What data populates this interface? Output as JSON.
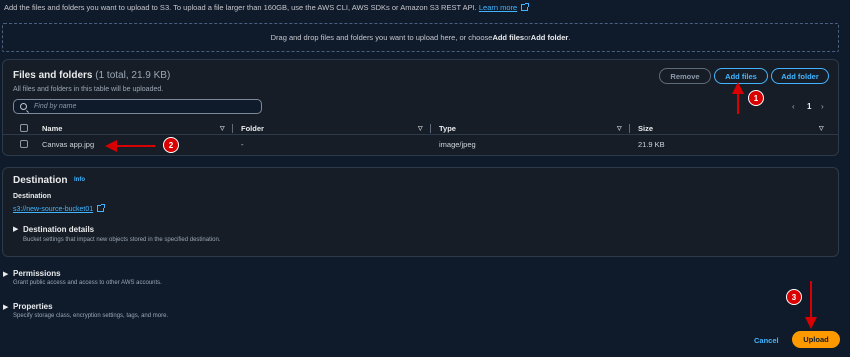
{
  "intro": {
    "text": "Add the files and folders you want to upload to S3. To upload a file larger than 160GB, use the AWS CLI, AWS SDKs or Amazon S3 REST API.",
    "learn_more": "Learn more"
  },
  "dropzone": {
    "prefix": "Drag and drop files and folders you want to upload here, or choose ",
    "add_files": "Add files",
    "or": " or ",
    "add_folder": "Add folder",
    "suffix": "."
  },
  "files_panel": {
    "title": "Files and folders",
    "count": "(1 total, 21.9 KB)",
    "subtitle": "All files and folders in this table will be uploaded.",
    "remove_label": "Remove",
    "add_files_label": "Add files",
    "add_folder_label": "Add folder",
    "search_placeholder": "Find by name",
    "pagination": {
      "prev": "‹",
      "page": "1",
      "next": "›"
    },
    "columns": [
      "Name",
      "Folder",
      "Type",
      "Size"
    ],
    "rows": [
      {
        "name": "Canvas app.jpg",
        "folder": "-",
        "type": "image/jpeg",
        "size": "21.9 KB"
      }
    ]
  },
  "destination": {
    "title": "Destination",
    "info": "Info",
    "label": "Destination",
    "value": "s3://new-source-bucket01",
    "details_title": "Destination details",
    "details_sub": "Bucket settings that impact new objects stored in the specified destination."
  },
  "permissions": {
    "title": "Permissions",
    "sub": "Grant public access and access to other AWS accounts."
  },
  "properties": {
    "title": "Properties",
    "sub": "Specify storage class, encryption settings, tags, and more."
  },
  "footer": {
    "cancel": "Cancel",
    "upload": "Upload"
  },
  "annotations": {
    "badge1": "1",
    "badge2": "2",
    "badge3": "3"
  },
  "colors": {
    "accent": "#42b4ff",
    "primary": "#ff9900",
    "annotation": "#d80000",
    "background": "#0f1b2a"
  }
}
